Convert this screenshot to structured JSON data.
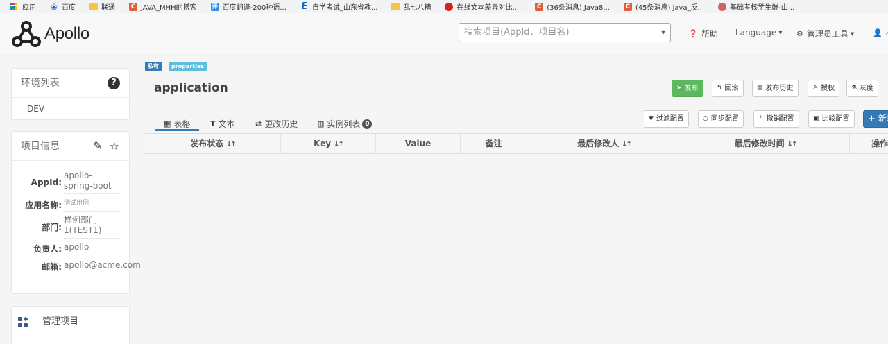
{
  "bookmarks": [
    {
      "label": "应用",
      "icon": "apps-grid-icon"
    },
    {
      "label": "百度",
      "icon": "baidu-paw-icon"
    },
    {
      "label": "联通",
      "icon": "folder-icon"
    },
    {
      "label": "JAVA_MHH的博客",
      "icon": "csdn-icon"
    },
    {
      "label": "百度翻译-200种语...",
      "icon": "baidu-translate-icon"
    },
    {
      "label": "自学考试_山东省教...",
      "icon": "e-icon"
    },
    {
      "label": "乱七八糟",
      "icon": "folder-icon"
    },
    {
      "label": "在线文本差异对比,...",
      "icon": "red-circle-icon"
    },
    {
      "label": "(36条消息) Java8...",
      "icon": "csdn-icon"
    },
    {
      "label": "(45条消息) java_反...",
      "icon": "csdn-icon"
    },
    {
      "label": "基础考核学生端-山...",
      "icon": "seal-icon"
    }
  ],
  "header": {
    "logo_text": "Apollo",
    "search_placeholder": "搜索项目(AppId、项目名)",
    "help": "帮助",
    "language": "Language",
    "admin_tools": "管理员工具",
    "user": "a"
  },
  "env_panel": {
    "title": "环境列表",
    "envs": [
      "DEV"
    ]
  },
  "project_panel": {
    "title": "项目信息",
    "fields": [
      {
        "label": "AppId:",
        "value": "apollo-spring-boot"
      },
      {
        "label": "应用名称:",
        "value": "测试用例"
      },
      {
        "label": "部门:",
        "value": "样例部门1(TEST1)"
      },
      {
        "label": "负责人:",
        "value": "apollo"
      },
      {
        "label": "邮箱:",
        "value": "apollo@acme.com"
      }
    ]
  },
  "manage_panel": {
    "title": "管理项目"
  },
  "namespace": {
    "tag_private": "私有",
    "tag_format": "properties",
    "name": "application",
    "buttons": {
      "release": "发布",
      "rollback": "回滚",
      "history": "发布历史",
      "grant": "授权",
      "gray": "灰度"
    },
    "tabs": {
      "table": "表格",
      "text": "文本",
      "change_history": "更改历史",
      "instances": "实例列表",
      "instances_count": "0"
    },
    "toolbar": {
      "filter": "过滤配置",
      "sync": "同步配置",
      "revoke": "撤销配置",
      "compare": "比较配置",
      "new": "新增"
    },
    "columns": [
      "发布状态",
      "Key",
      "Value",
      "备注",
      "最后修改人",
      "最后修改时间",
      "操作"
    ]
  }
}
